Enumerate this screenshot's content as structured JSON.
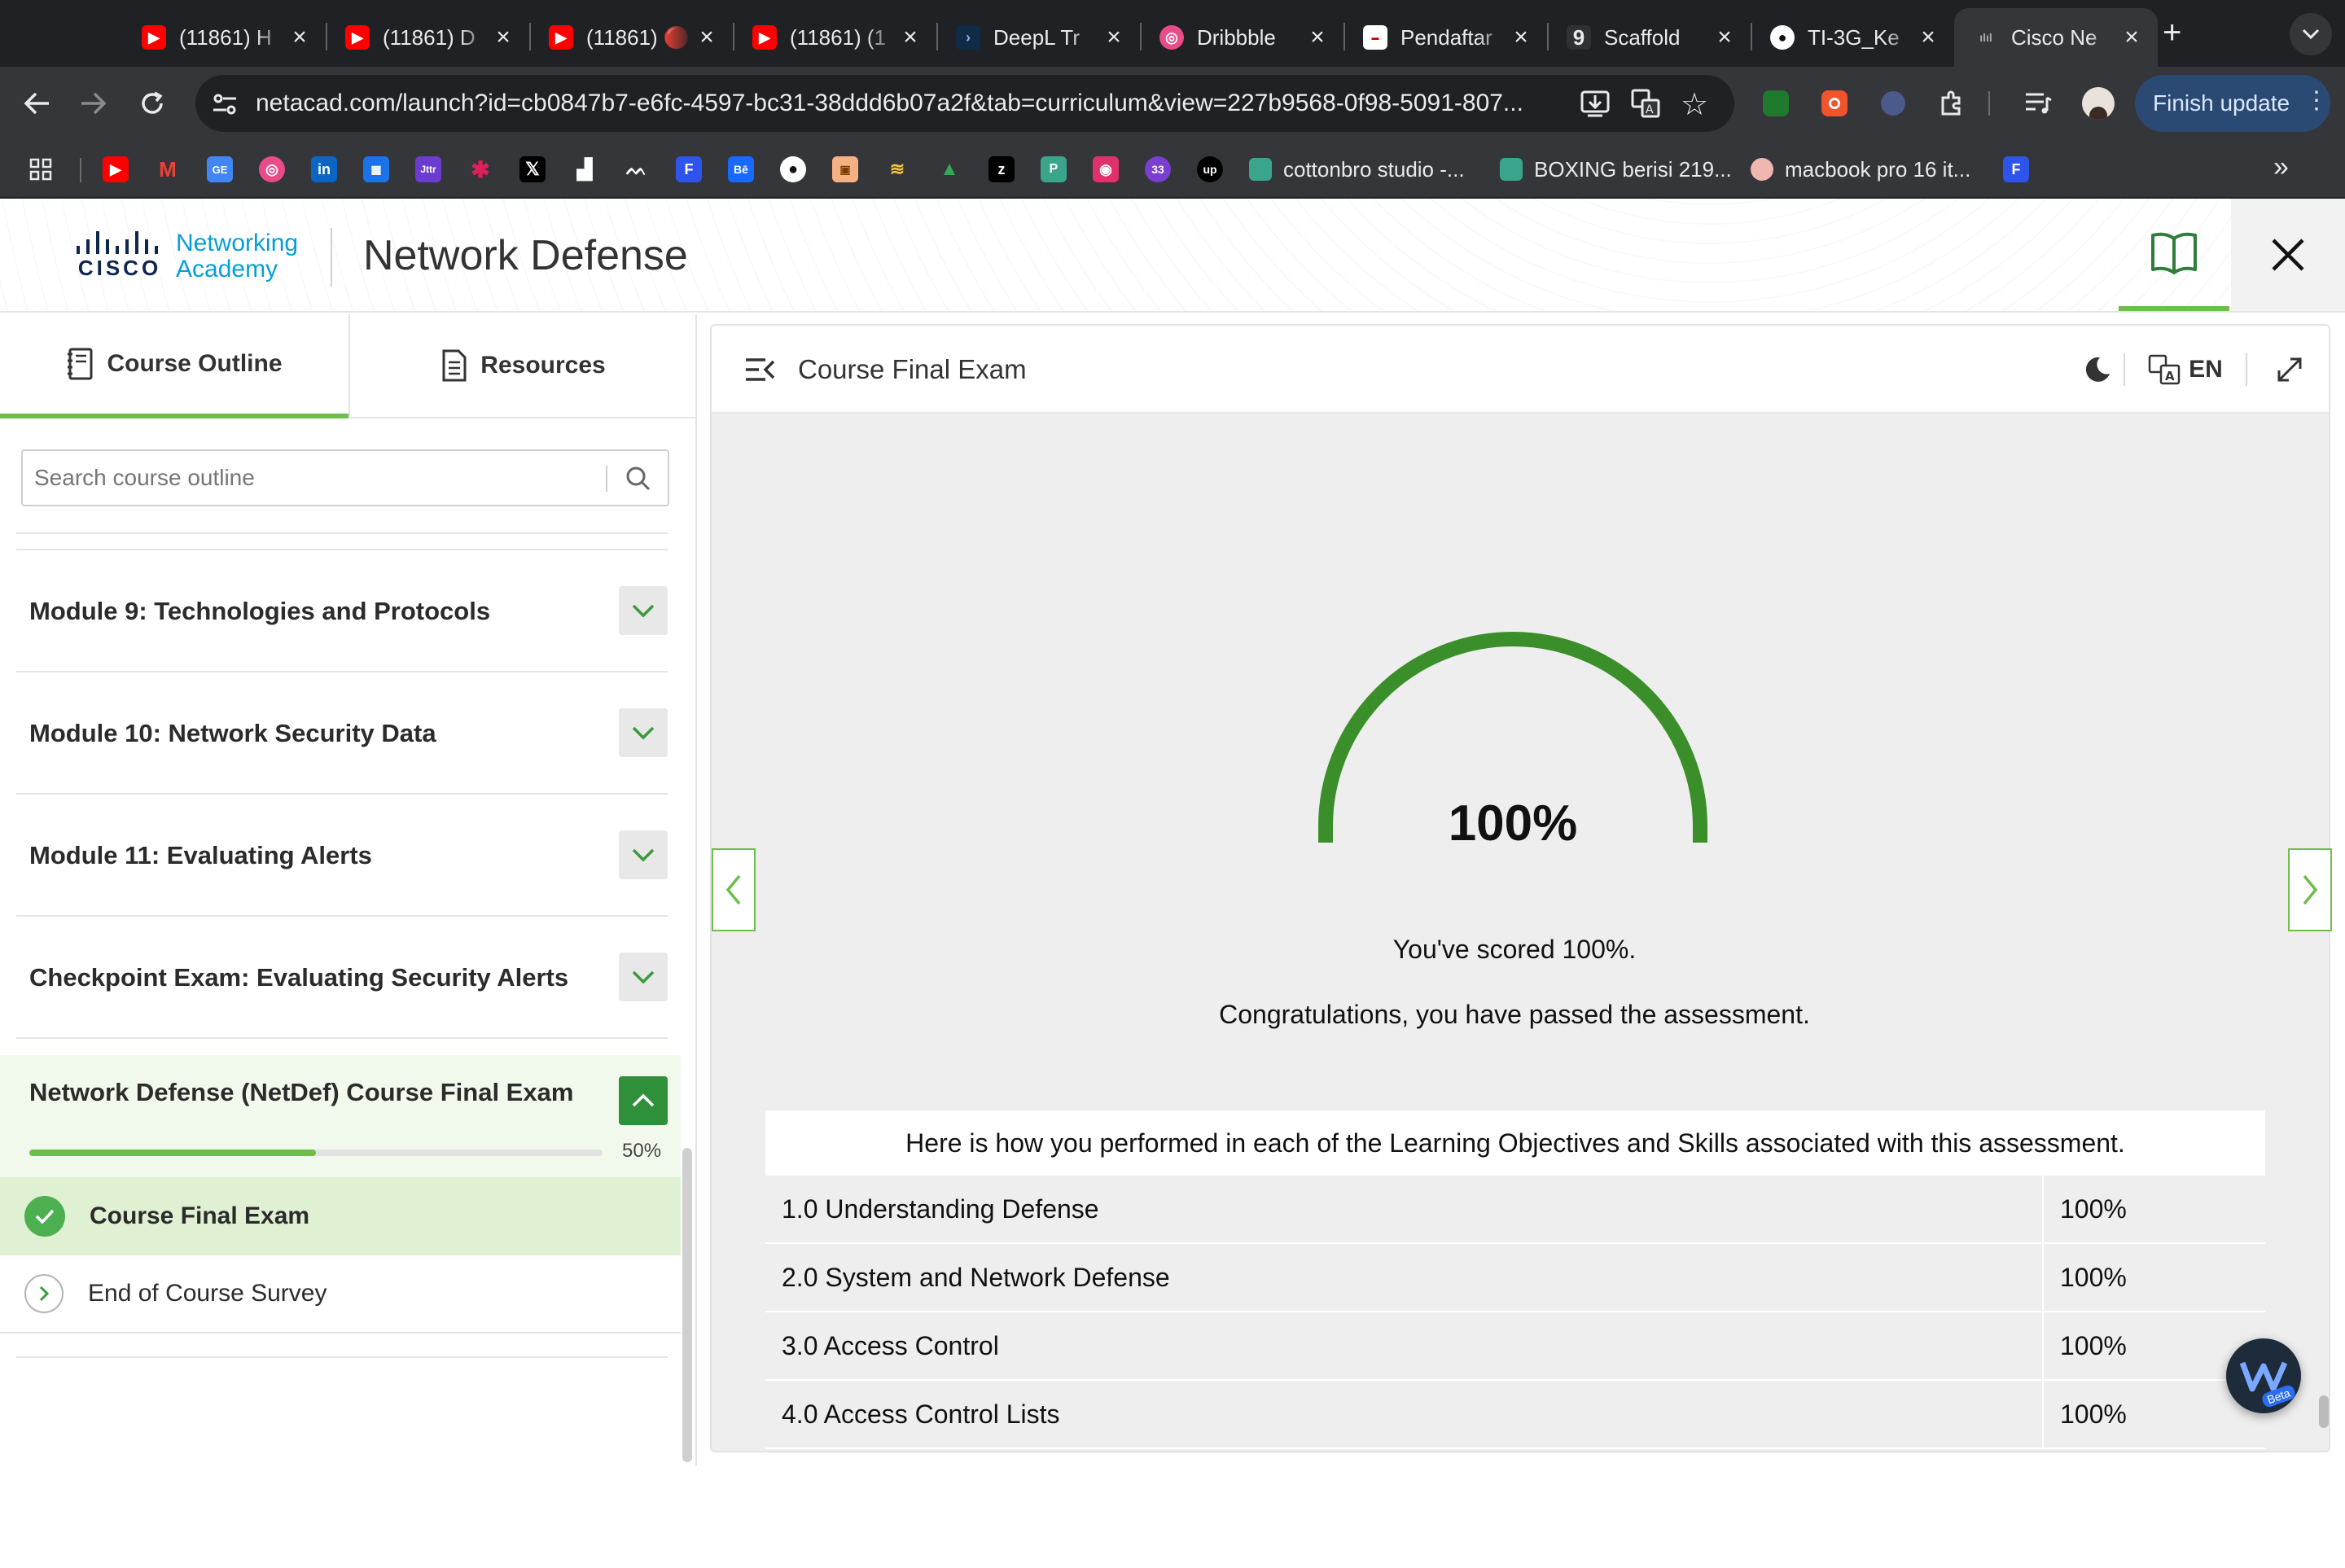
{
  "browser": {
    "tabs": [
      {
        "title": "(11861) H",
        "icon": "youtube-icon",
        "color": "#ff0000"
      },
      {
        "title": "(11861) D",
        "icon": "youtube-icon",
        "color": "#ff0000"
      },
      {
        "title": "(11861) 🔴",
        "icon": "youtube-icon",
        "color": "#ff0000"
      },
      {
        "title": "(11861) (1",
        "icon": "youtube-icon",
        "color": "#ff0000"
      },
      {
        "title": "DeepL Tr",
        "icon": "deepl-icon",
        "color": "#0f2b46"
      },
      {
        "title": "Dribbble",
        "icon": "dribbble-icon",
        "color": "#ea4c89"
      },
      {
        "title": "Pendaftar",
        "icon": "pendaftaran-icon",
        "color": "#ffffff"
      },
      {
        "title": "Scaffold",
        "icon": "scaffold-icon",
        "color": "#303134"
      },
      {
        "title": "TI-3G_Ke",
        "icon": "github-icon",
        "color": "#ffffff"
      },
      {
        "title": "Cisco Ne",
        "icon": "cisco-icon",
        "color": "#8a8a8a",
        "active": true
      }
    ],
    "url": "netacad.com/launch?id=cb0847b7-e6fc-4597-bc31-38ddd6b07a2f&tab=curriculum&view=227b9568-0f98-5091-807...",
    "finish_update": "Finish update",
    "bookmarks": [
      {
        "label": "cottonbro studio -..."
      },
      {
        "label": "BOXING berisi 219..."
      },
      {
        "label": "macbook pro 16 it..."
      }
    ],
    "bookmark_badge": "33"
  },
  "header": {
    "brand_line1": "Networking",
    "brand_line2": "Academy",
    "brand_wordmark": "CISCO",
    "course_title": "Network Defense"
  },
  "sidebar": {
    "tabs": {
      "outline": "Course Outline",
      "resources": "Resources"
    },
    "search_placeholder": "Search course outline",
    "modules": [
      {
        "title": "Module 9: Technologies and Protocols"
      },
      {
        "title": "Module 10: Network Security Data"
      },
      {
        "title": "Module 11: Evaluating Alerts"
      },
      {
        "title": "Checkpoint Exam: Evaluating Security Alerts"
      }
    ],
    "active_module": {
      "title": "Network Defense (NetDef) Course Final Exam",
      "progress_label": "50%",
      "progress": 0.5,
      "items": [
        {
          "title": "Course Final Exam",
          "status": "completed"
        },
        {
          "title": "End of Course Survey",
          "status": "not-started"
        }
      ]
    }
  },
  "content": {
    "title": "Course Final Exam",
    "language": "EN",
    "score_label": "100%",
    "score": 1.0,
    "scored_text": "You've scored 100%.",
    "congrats_text": "Congratulations, you have passed the assessment.",
    "performance_heading": "Here is how you performed in each of the Learning Objectives and Skills associated with this assessment.",
    "objectives": [
      {
        "name": "1.0 Understanding Defense",
        "score": "100%"
      },
      {
        "name": "2.0 System and Network Defense",
        "score": "100%"
      },
      {
        "name": "3.0 Access Control",
        "score": "100%"
      },
      {
        "name": "4.0 Access Control Lists",
        "score": "100%"
      }
    ],
    "widget_badge": "Beta"
  },
  "colors": {
    "accent_green": "#6ebe4a",
    "gauge_green": "#3b8f2a",
    "cisco_blue": "#049fd9",
    "completed_bg": "#dff0d3"
  }
}
